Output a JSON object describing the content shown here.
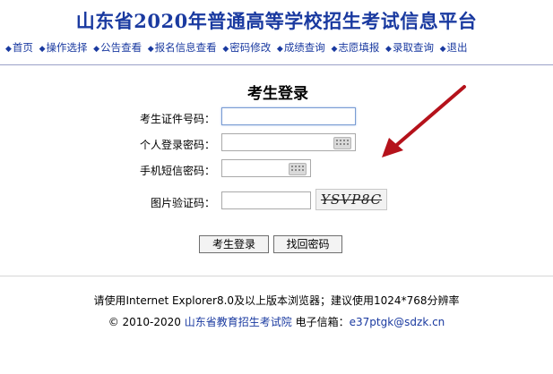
{
  "header": {
    "title": "山东省2020年普通高等学校招生考试信息平台"
  },
  "nav": {
    "bullet": "◆",
    "items": [
      "首页",
      "操作选择",
      "公告查看",
      "报名信息查看",
      "密码修改",
      "成绩查询",
      "志愿填报",
      "录取查询",
      "退出"
    ]
  },
  "login": {
    "title": "考生登录",
    "id_label": "考生证件号码：",
    "password_label": "个人登录密码：",
    "sms_label": "手机短信密码：",
    "captcha_label": "图片验证码：",
    "captcha_text": "YSVP8C",
    "login_button": "考生登录",
    "recover_button": "找回密码"
  },
  "footer": {
    "browser_note": "请使用Internet Explorer8.0及以上版本浏览器；建议使用1024*768分辨率",
    "copyright": "© 2010-2020",
    "org_link": "山东省教育招生考试院",
    "email_label": "电子信箱：",
    "email": "e37ptgk@sdzk.cn"
  },
  "colors": {
    "title": "#1a3aa0",
    "arrow": "#b5121b"
  }
}
